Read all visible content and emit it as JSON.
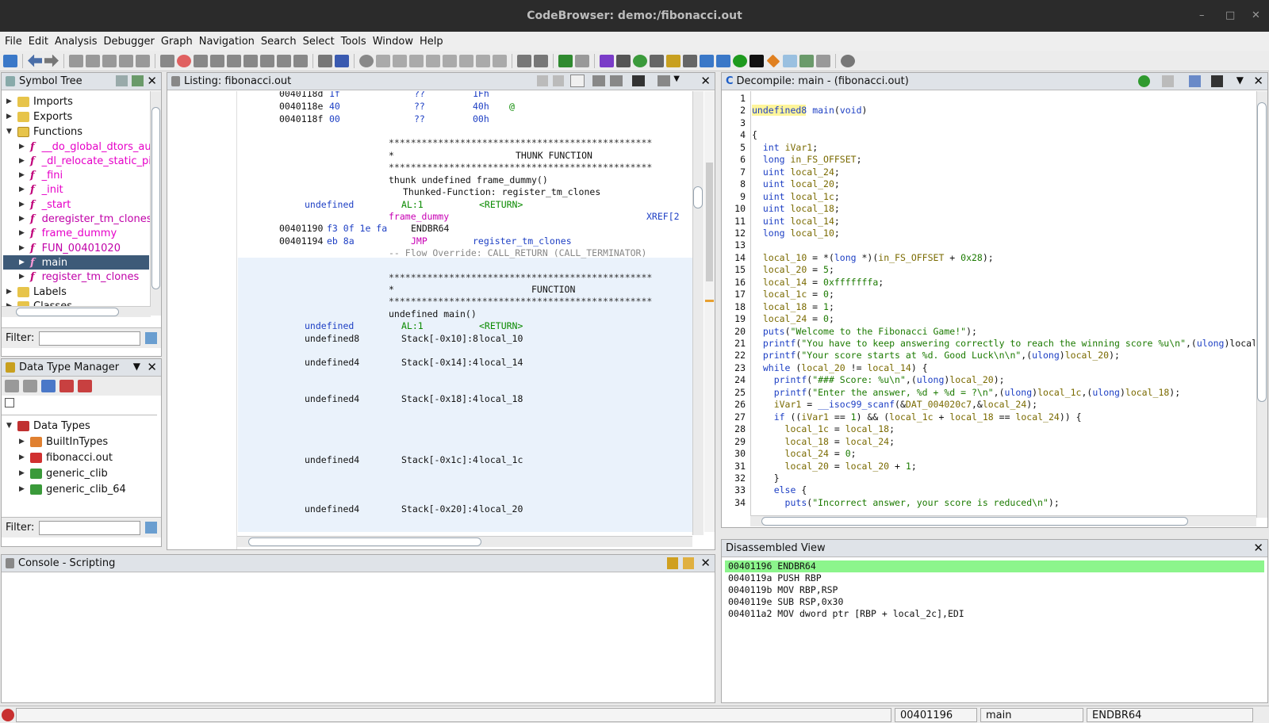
{
  "window": {
    "title": "CodeBrowser: demo:/fibonacci.out"
  },
  "menu": [
    "File",
    "Edit",
    "Analysis",
    "Debugger",
    "Graph",
    "Navigation",
    "Search",
    "Select",
    "Tools",
    "Window",
    "Help"
  ],
  "symbol_tree": {
    "title": "Symbol Tree",
    "items": [
      {
        "label": "Imports",
        "level": 0,
        "icon": "folder-icon"
      },
      {
        "label": "Exports",
        "level": 0,
        "icon": "folder-icon"
      },
      {
        "label": "Functions",
        "level": 0,
        "icon": "folder-open-icon"
      },
      {
        "label": "__do_global_dtors_aux",
        "level": 1,
        "icon": "function-icon"
      },
      {
        "label": "_dl_relocate_static_pie",
        "level": 1,
        "icon": "function-icon"
      },
      {
        "label": "_fini",
        "level": 1,
        "icon": "function-icon"
      },
      {
        "label": "_init",
        "level": 1,
        "icon": "function-icon"
      },
      {
        "label": "_start",
        "level": 1,
        "icon": "function-icon"
      },
      {
        "label": "deregister_tm_clones",
        "level": 1,
        "icon": "function-icon"
      },
      {
        "label": "frame_dummy",
        "level": 1,
        "icon": "function-icon"
      },
      {
        "label": "FUN_00401020",
        "level": 1,
        "icon": "function-icon"
      },
      {
        "label": "main",
        "level": 1,
        "icon": "function-icon"
      },
      {
        "label": "register_tm_clones",
        "level": 1,
        "icon": "function-icon"
      },
      {
        "label": "Labels",
        "level": 0,
        "icon": "folder-icon"
      },
      {
        "label": "Classes",
        "level": 0,
        "icon": "folder-icon"
      }
    ],
    "filter_label": "Filter:"
  },
  "data_type_manager": {
    "title": "Data Type Manager",
    "root": "Data Types",
    "items": [
      "BuiltInTypes",
      "fibonacci.out",
      "generic_clib",
      "generic_clib_64"
    ],
    "filter_label": "Filter:"
  },
  "listing": {
    "title": "Listing:  fibonacci.out",
    "lines": [
      [
        "0040118d",
        "1f",
        "??",
        "1Fh",
        ""
      ],
      [
        "0040118e",
        "40",
        "??",
        "40h",
        "@"
      ],
      [
        "0040118f",
        "00",
        "??",
        "00h",
        ""
      ]
    ],
    "thunk_header": "THUNK FUNCTION",
    "thunk_sig": "thunk undefined frame_dummy()",
    "thunked": "Thunked-Function: register_tm_clones",
    "ret_type": "undefined",
    "ret_reg": "AL:1",
    "ret_tag": "<RETURN>",
    "label_frame_dummy": "frame_dummy",
    "xref": "XREF[2",
    "endbr_addr": "00401190",
    "endbr_bytes": "f3 0f 1e fa",
    "endbr_mn": "ENDBR64",
    "jmp_addr": "00401194",
    "jmp_bytes": "eb 8a",
    "jmp_mn": "JMP",
    "jmp_target": "register_tm_clones",
    "flow": "-- Flow Override: CALL_RETURN (CALL_TERMINATOR)",
    "func_header": "FUNCTION",
    "main_sig": "undefined main()",
    "stack_vars": [
      [
        "undefined8",
        "Stack[-0x10]:8",
        "local_10"
      ],
      [
        "undefined4",
        "Stack[-0x14]:4",
        "local_14"
      ],
      [
        "undefined4",
        "Stack[-0x18]:4",
        "local_18"
      ],
      [
        "undefined4",
        "Stack[-0x1c]:4",
        "local_1c"
      ],
      [
        "undefined4",
        "Stack[-0x20]:4",
        "local_20"
      ]
    ]
  },
  "decompile": {
    "title": "Decompile: main -  (fibonacci.out)",
    "lines": [
      "",
      "undefined8 main(void)",
      "",
      "{",
      "  int iVar1;",
      "  long in_FS_OFFSET;",
      "  uint local_24;",
      "  uint local_20;",
      "  uint local_1c;",
      "  uint local_18;",
      "  uint local_14;",
      "  long local_10;",
      "",
      "  local_10 = *(long *)(in_FS_OFFSET + 0x28);",
      "  local_20 = 5;",
      "  local_14 = 0xfffffffa;",
      "  local_1c = 0;",
      "  local_18 = 1;",
      "  local_24 = 0;",
      "  puts(\"Welcome to the Fibonacci Game!\");",
      "  printf(\"You have to keep answering correctly to reach the winning score %u\\n\",(ulong)local_",
      "  printf(\"Your score starts at %d. Good Luck\\n\\n\",(ulong)local_20);",
      "  while (local_20 != local_14) {",
      "    printf(\"### Score: %u\\n\",(ulong)local_20);",
      "    printf(\"Enter the answer, %d + %d = ?\\n\",(ulong)local_1c,(ulong)local_18);",
      "    iVar1 = __isoc99_scanf(&DAT_004020c7,&local_24);",
      "    if ((iVar1 == 1) && (local_1c + local_18 == local_24)) {",
      "      local_1c = local_18;",
      "      local_18 = local_24;",
      "      local_24 = 0;",
      "      local_20 = local_20 + 1;",
      "    }",
      "    else {",
      "      puts(\"Incorrect answer, your score is reduced\\n\");"
    ]
  },
  "console": {
    "title": "Console - Scripting"
  },
  "disassembled": {
    "title": "Disassembled View",
    "lines": [
      "00401196 ENDBR64",
      "0040119a PUSH RBP",
      "0040119b MOV RBP,RSP",
      "0040119e SUB RSP,0x30",
      "004011a2 MOV dword ptr [RBP + local_2c],EDI"
    ]
  },
  "status": {
    "address": "00401196",
    "function": "main",
    "instruction": "ENDBR64"
  },
  "colors": {
    "selection": "#3d5a78",
    "highlight": "#8cf58c",
    "panel_header": "#dfe3e8"
  }
}
